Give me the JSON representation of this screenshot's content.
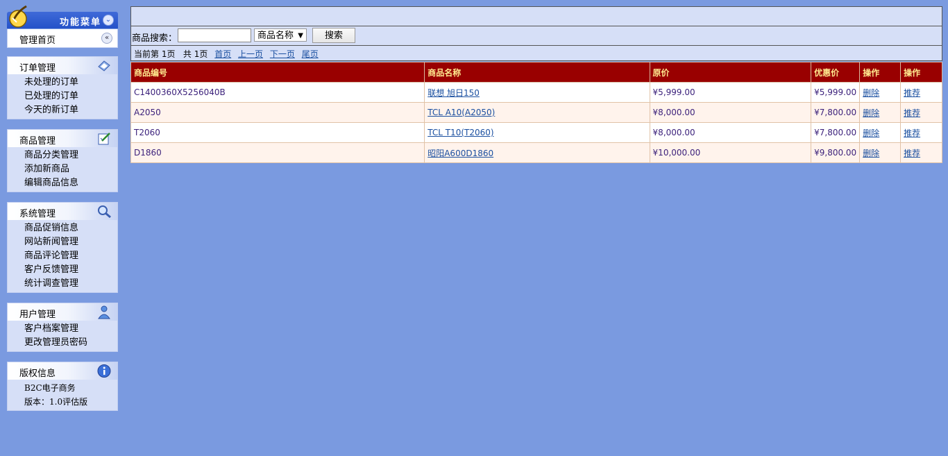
{
  "sidebar": {
    "menu_title": "功能菜单",
    "home_label": "管理首页",
    "groups": [
      {
        "title": "订单管理",
        "icon": "order-icon",
        "items": [
          "未处理的订单",
          "已处理的订单",
          "今天的新订单"
        ]
      },
      {
        "title": "商品管理",
        "icon": "edit-icon",
        "items": [
          "商品分类管理",
          "添加新商品",
          "编辑商品信息"
        ]
      },
      {
        "title": "系统管理",
        "icon": "magnifier-icon",
        "items": [
          "商品促销信息",
          "网站新闻管理",
          "商品评论管理",
          "客户反馈管理",
          "统计调查管理"
        ]
      },
      {
        "title": "用户管理",
        "icon": "user-icon",
        "items": [
          "客户档案管理",
          "更改管理员密码"
        ]
      },
      {
        "title": "版权信息",
        "icon": "info-icon",
        "items": [
          "B2C电子商务",
          "版本：1.0评估版"
        ]
      }
    ]
  },
  "search": {
    "label": "商品搜索：",
    "input_value": "",
    "select_value": "商品名称",
    "button_label": "搜索"
  },
  "pager": {
    "current": "当前第 1页",
    "total": "共 1页",
    "first": "首页",
    "prev": "上一页",
    "next": "下一页",
    "last": "尾页"
  },
  "table": {
    "headers": [
      "商品编号",
      "商品名称",
      "原价",
      "优惠价",
      "操作",
      "操作"
    ],
    "rows": [
      {
        "id": "C1400360X5256040B",
        "name": "联想 旭日150",
        "price": "¥5,999.00",
        "sale": "¥5,999.00",
        "del": "删除",
        "rec": "推荐"
      },
      {
        "id": "A2050",
        "name": "TCL A10(A2050)",
        "price": "¥8,000.00",
        "sale": "¥7,800.00",
        "del": "删除",
        "rec": "推荐"
      },
      {
        "id": "T2060",
        "name": "TCL T10(T2060)",
        "price": "¥8,000.00",
        "sale": "¥7,800.00",
        "del": "删除",
        "rec": "推荐"
      },
      {
        "id": "D1860",
        "name": "昭阳A600D1860",
        "price": "¥10,000.00",
        "sale": "¥9,800.00",
        "del": "删除",
        "rec": "推荐"
      }
    ]
  },
  "colors": {
    "page_bg": "#7a9ae0",
    "header_bg": "#990000",
    "header_text": "#ffe98f",
    "panel_bg": "#d6dff7"
  }
}
